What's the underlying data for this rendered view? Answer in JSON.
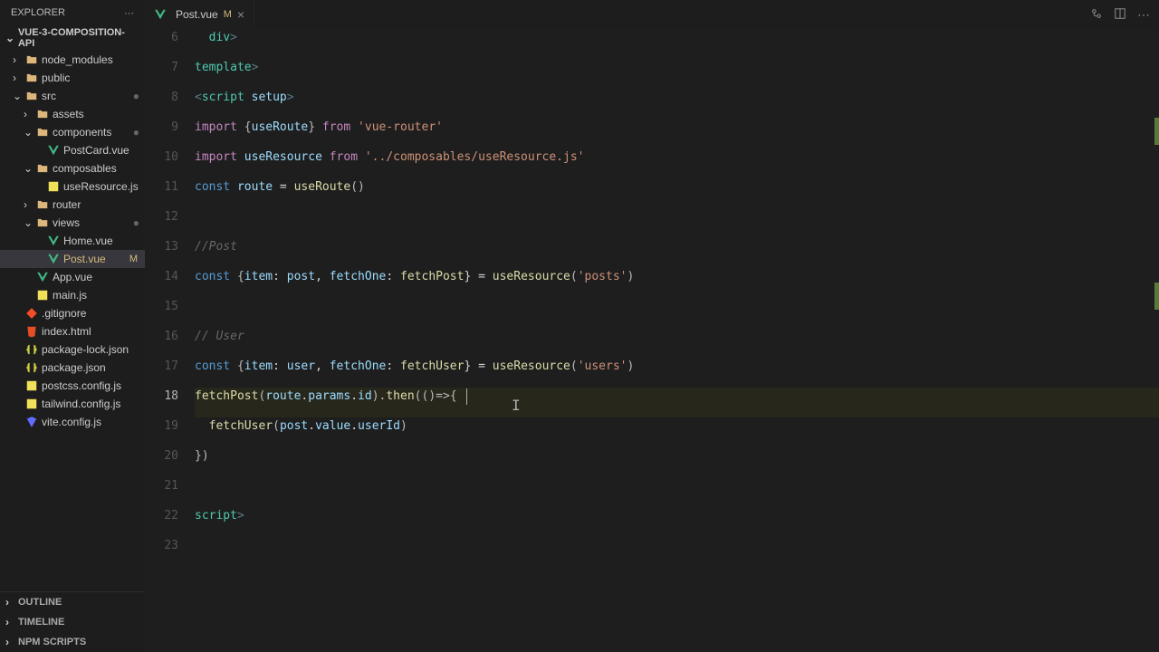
{
  "sidebar": {
    "title": "EXPLORER",
    "project": "VUE-3-COMPOSITION-API",
    "items": [
      {
        "type": "folder",
        "label": "node_modules",
        "indent": 1,
        "expanded": false,
        "color": "folder"
      },
      {
        "type": "folder",
        "label": "public",
        "indent": 1,
        "expanded": false,
        "color": "folder"
      },
      {
        "type": "folder",
        "label": "src",
        "indent": 1,
        "expanded": true,
        "color": "folder",
        "dot": true
      },
      {
        "type": "folder",
        "label": "assets",
        "indent": 2,
        "expanded": false,
        "color": "folder"
      },
      {
        "type": "folder",
        "label": "components",
        "indent": 2,
        "expanded": true,
        "color": "folder",
        "dot": true
      },
      {
        "type": "file",
        "label": "PostCard.vue",
        "indent": 3,
        "color": "vue"
      },
      {
        "type": "folder",
        "label": "composables",
        "indent": 2,
        "expanded": true,
        "color": "folder"
      },
      {
        "type": "file",
        "label": "useResource.js",
        "indent": 3,
        "color": "js"
      },
      {
        "type": "folder",
        "label": "router",
        "indent": 2,
        "expanded": false,
        "color": "folder"
      },
      {
        "type": "folder",
        "label": "views",
        "indent": 2,
        "expanded": true,
        "color": "folder",
        "dot": true
      },
      {
        "type": "file",
        "label": "Home.vue",
        "indent": 3,
        "color": "vue"
      },
      {
        "type": "file",
        "label": "Post.vue",
        "indent": 3,
        "color": "vue",
        "status": "M",
        "active": true,
        "modified": true
      },
      {
        "type": "file",
        "label": "App.vue",
        "indent": 2,
        "color": "vue"
      },
      {
        "type": "file",
        "label": "main.js",
        "indent": 2,
        "color": "js"
      },
      {
        "type": "file",
        "label": ".gitignore",
        "indent": 1,
        "color": "git"
      },
      {
        "type": "file",
        "label": "index.html",
        "indent": 1,
        "color": "html"
      },
      {
        "type": "file",
        "label": "package-lock.json",
        "indent": 1,
        "color": "json"
      },
      {
        "type": "file",
        "label": "package.json",
        "indent": 1,
        "color": "json"
      },
      {
        "type": "file",
        "label": "postcss.config.js",
        "indent": 1,
        "color": "js"
      },
      {
        "type": "file",
        "label": "tailwind.config.js",
        "indent": 1,
        "color": "js"
      },
      {
        "type": "file",
        "label": "vite.config.js",
        "indent": 1,
        "color": "vite"
      }
    ],
    "bottom": [
      "OUTLINE",
      "TIMELINE",
      "NPM SCRIPTS"
    ]
  },
  "tab": {
    "filename": "Post.vue",
    "status": "M"
  },
  "editor": {
    "lines": [
      {
        "n": 6
      },
      {
        "n": 7
      },
      {
        "n": 8
      },
      {
        "n": 9
      },
      {
        "n": 10
      },
      {
        "n": 11
      },
      {
        "n": 12
      },
      {
        "n": 13
      },
      {
        "n": 14
      },
      {
        "n": 15
      },
      {
        "n": 16
      },
      {
        "n": 17
      },
      {
        "n": 18,
        "active": true
      },
      {
        "n": 19
      },
      {
        "n": 20
      },
      {
        "n": 21
      },
      {
        "n": 22
      },
      {
        "n": 23
      }
    ],
    "code": {
      "l6a": "</",
      "l6b": "div",
      "l6c": ">",
      "l7a": "</",
      "l7b": "template",
      "l7c": ">",
      "l8a": "<",
      "l8b": "script",
      "l8c": " setup",
      "l8d": ">",
      "l9a": "import",
      "l9b": " {",
      "l9c": "useRoute",
      "l9d": "} ",
      "l9e": "from",
      "l9f": " ",
      "l9g": "'vue-router'",
      "l10a": "import",
      "l10b": " ",
      "l10c": "useResource",
      "l10d": " ",
      "l10e": "from",
      "l10f": " ",
      "l10g": "'../composables/useResource.js'",
      "l11a": "const",
      "l11b": " ",
      "l11c": "route",
      "l11d": " = ",
      "l11e": "useRoute",
      "l11f": "()",
      "l13a": "//Post",
      "l14a": "const",
      "l14b": " {",
      "l14c": "item",
      "l14d": ": ",
      "l14e": "post",
      "l14f": ", ",
      "l14g": "fetchOne",
      "l14h": ": ",
      "l14i": "fetchPost",
      "l14j": "} = ",
      "l14k": "useResource",
      "l14l": "(",
      "l14m": "'posts'",
      "l14n": ")",
      "l16a": "// User",
      "l17a": "const",
      "l17b": " {",
      "l17c": "item",
      "l17d": ": ",
      "l17e": "user",
      "l17f": ", ",
      "l17g": "fetchOne",
      "l17h": ": ",
      "l17i": "fetchUser",
      "l17j": "} = ",
      "l17k": "useResource",
      "l17l": "(",
      "l17m": "'users'",
      "l17n": ")",
      "l18a": "fetchPost",
      "l18b": "(",
      "l18c": "route",
      "l18d": ".",
      "l18e": "params",
      "l18f": ".",
      "l18g": "id",
      "l18h": ").",
      "l18i": "then",
      "l18j": "(()=>",
      "l18k": "{",
      "l19a": "  ",
      "l19b": "fetchUser",
      "l19c": "(",
      "l19d": "post",
      "l19e": ".",
      "l19f": "value",
      "l19g": ".",
      "l19h": "userId",
      "l19i": ")",
      "l20a": "})",
      "l22a": "</",
      "l22b": "script",
      "l22c": ">"
    }
  }
}
